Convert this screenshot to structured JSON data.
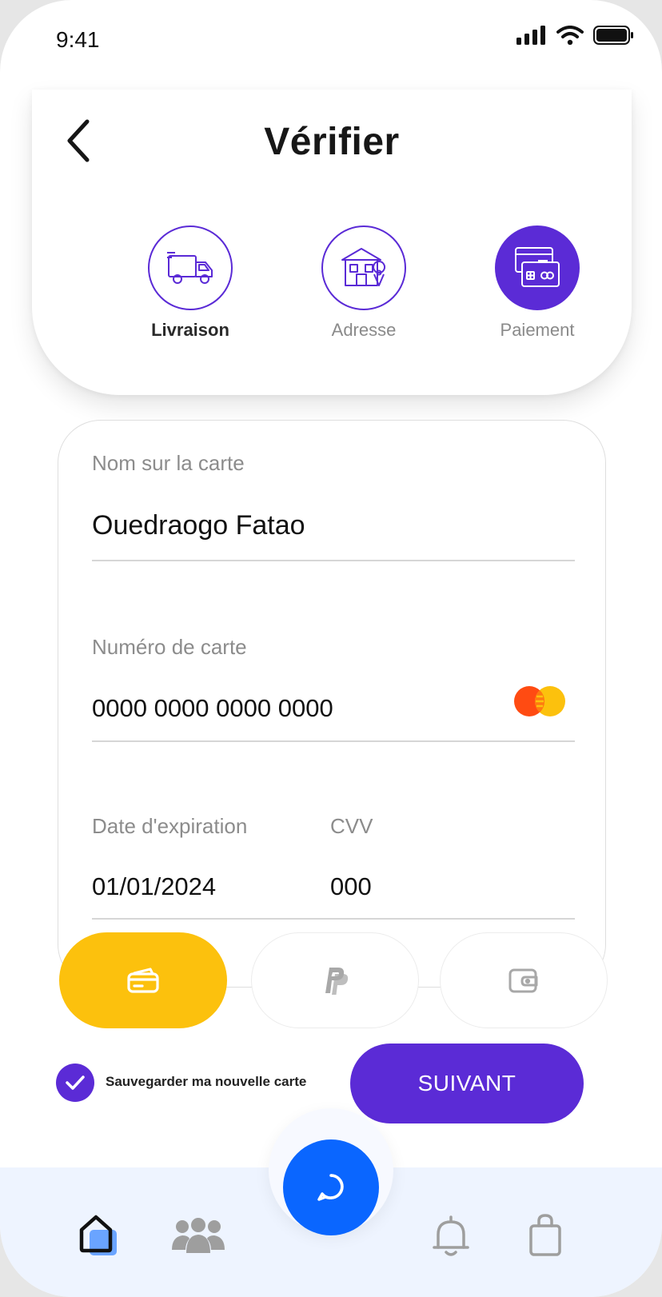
{
  "status_bar": {
    "time": "9:41"
  },
  "header": {
    "title": "Vérifier"
  },
  "steps": [
    {
      "label": "Livraison",
      "icon": "truck-icon",
      "state": "done"
    },
    {
      "label": "Adresse",
      "icon": "house-location-icon",
      "state": "pending"
    },
    {
      "label": "Paiement",
      "icon": "credit-card-icon",
      "state": "active"
    }
  ],
  "form": {
    "name_label": "Nom sur la carte",
    "name_value": "Ouedraogo Fatao",
    "number_label": "Numéro de carte",
    "number_value": "0000 0000 0000 0000",
    "expiry_label": "Date d'expiration",
    "expiry_value": "01/01/2024",
    "cvv_label": "CVV",
    "cvv_value": "000"
  },
  "payment_methods": [
    {
      "icon": "card-icon",
      "selected": true
    },
    {
      "icon": "paypal-icon",
      "selected": false
    },
    {
      "icon": "wallet-icon",
      "selected": false
    }
  ],
  "save_card_label": "Sauvegarder ma nouvelle carte",
  "next_label": "SUIVANT",
  "nav": [
    "home-icon",
    "people-icon",
    "chat-icon",
    "bell-icon",
    "shopping-bag-icon"
  ],
  "colors": {
    "primary": "#5b2bd6",
    "accent": "#fcc10d",
    "fab": "#0a66ff"
  }
}
